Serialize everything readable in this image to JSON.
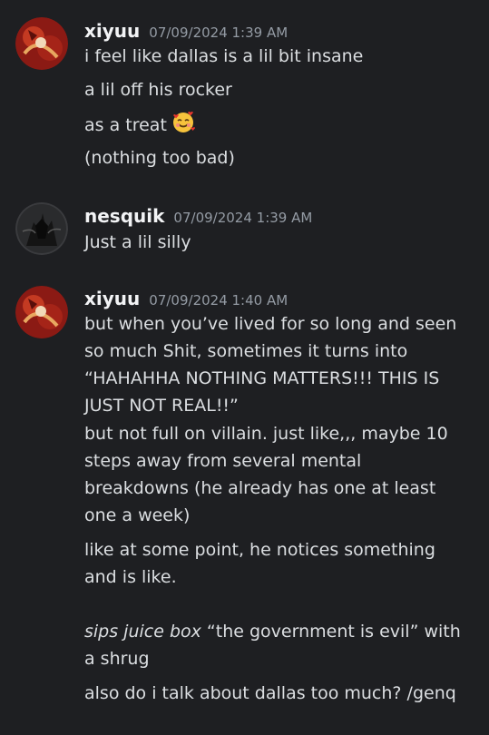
{
  "messages": [
    {
      "username": "xiyuu",
      "timestamp": "07/09/2024 1:39 AM",
      "lines": [
        "i feel like dallas is a lil bit insane",
        "a lil off his rocker",
        "as a treat",
        "(nothing too bad)"
      ],
      "emoji": "smiling-face-with-hearts"
    },
    {
      "username": "nesquik",
      "timestamp": "07/09/2024 1:39 AM",
      "lines": [
        "Just a lil silly"
      ]
    },
    {
      "username": "xiyuu",
      "timestamp": "07/09/2024 1:40 AM",
      "lines": [
        "but when you’ve lived for so long and seen",
        "so much Shit, sometimes it turns into",
        "“HAHAHHA NOTHING MATTERS!!! THIS IS",
        "JUST NOT REAL!!”",
        "but not full on villain. just like,,, maybe 10",
        "steps away from several mental",
        "breakdowns (he already has one at least",
        "one a week)",
        "like at some point, he notices something",
        "and is like.",
        "sips juice box",
        " “the government is evil” with",
        "a shrug",
        "also do i talk about dallas too much? /genq"
      ]
    }
  ],
  "colors": {
    "background": "#1e1f22",
    "username": "#f2f3f5",
    "timestamp": "#949ba4",
    "text": "#dbdee1"
  }
}
